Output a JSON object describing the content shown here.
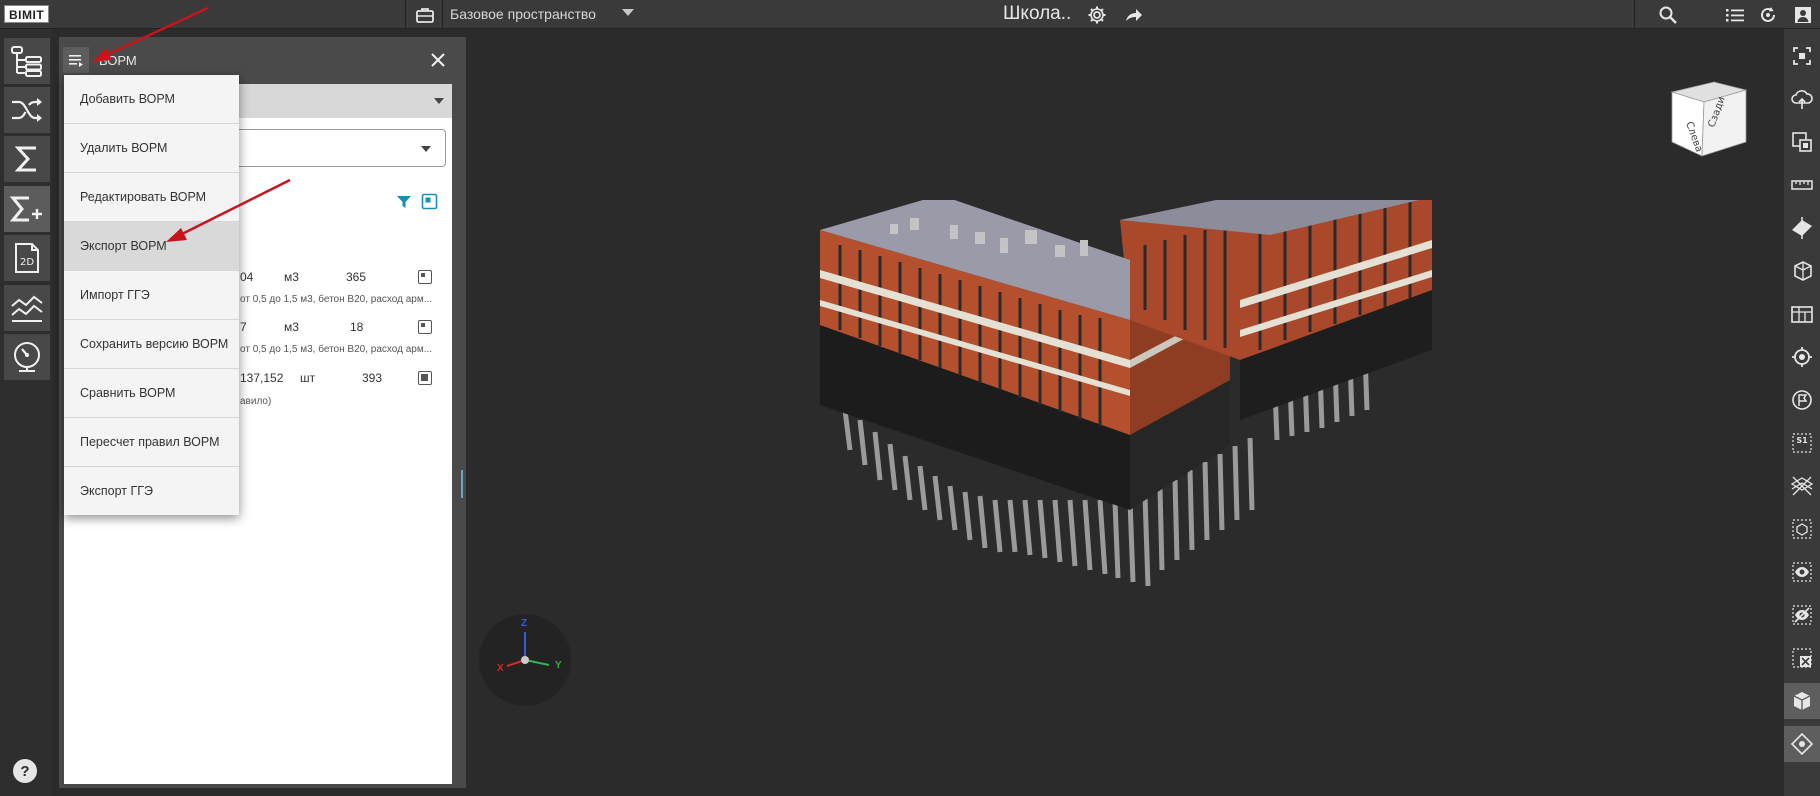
{
  "app": {
    "logo_text": "BIMIT"
  },
  "topbar": {
    "space_label": "Базовое пространство",
    "model_title": "Школа..",
    "icons": [
      "briefcase-icon",
      "gear-icon",
      "share-icon",
      "search-icon",
      "list-icon",
      "sync-icon",
      "user-icon"
    ]
  },
  "left_rail": {
    "tools": [
      "tree-icon",
      "shuffle-icon",
      "sigma-icon",
      "sigma-plus-icon",
      "2d-icon",
      "chart-icon",
      "gauge-icon"
    ],
    "tool_2d_label": "2D",
    "active_tool": "sigma-plus-icon",
    "help_label": "?"
  },
  "panel": {
    "title": "ВОРМ",
    "rows": [
      {
        "value": "04",
        "unit": "м3",
        "count": "365",
        "desc": "от 0,5 до 1,5 м3, бетон В20, расход арм..."
      },
      {
        "value": "7",
        "unit": "м3",
        "count": "18",
        "desc": "от 0,5 до 1,5 м3, бетон В20, расход арм..."
      },
      {
        "value": "137,152",
        "unit": "шт",
        "count": "393",
        "desc": "авило)"
      }
    ]
  },
  "menu": {
    "items": [
      {
        "label": "Добавить ВОРМ"
      },
      {
        "label": "Удалить ВОРМ"
      },
      {
        "label": "Редактировать ВОРМ"
      },
      {
        "label": "Экспорт ВОРМ",
        "highlighted": true
      },
      {
        "label": "Импорт ГГЭ"
      },
      {
        "label": "Сохранить версию ВОРМ"
      },
      {
        "label": "Сравнить ВОРМ"
      },
      {
        "label": "Пересчет правил ВОРМ"
      },
      {
        "label": "Экспорт ГГЭ"
      }
    ]
  },
  "viewport": {
    "viewcube": {
      "face_front": "Слева",
      "face_right": "Сзади"
    },
    "axes": {
      "x": "X",
      "y": "Y",
      "z": "Z"
    }
  },
  "right_rail": {
    "tools": [
      "fit-view-icon",
      "cloud-icon",
      "focus-icon",
      "ruler-icon",
      "section-plane-icon",
      "section-box-icon",
      "floor-plan-icon",
      "locate-icon",
      "flag-icon",
      "sheet-icon",
      "cross-section-icon",
      "select-box-icon",
      "show-icon",
      "hide-icon",
      "remove-icon",
      "iso-box-icon",
      "navigation-icon"
    ],
    "sheet_label": "S1"
  },
  "colors": {
    "accent": "#1a8fb5",
    "annotation_arrow": "#c8141c",
    "building_brick": "#b4502e",
    "menu_hover": "#d9d9d9"
  }
}
